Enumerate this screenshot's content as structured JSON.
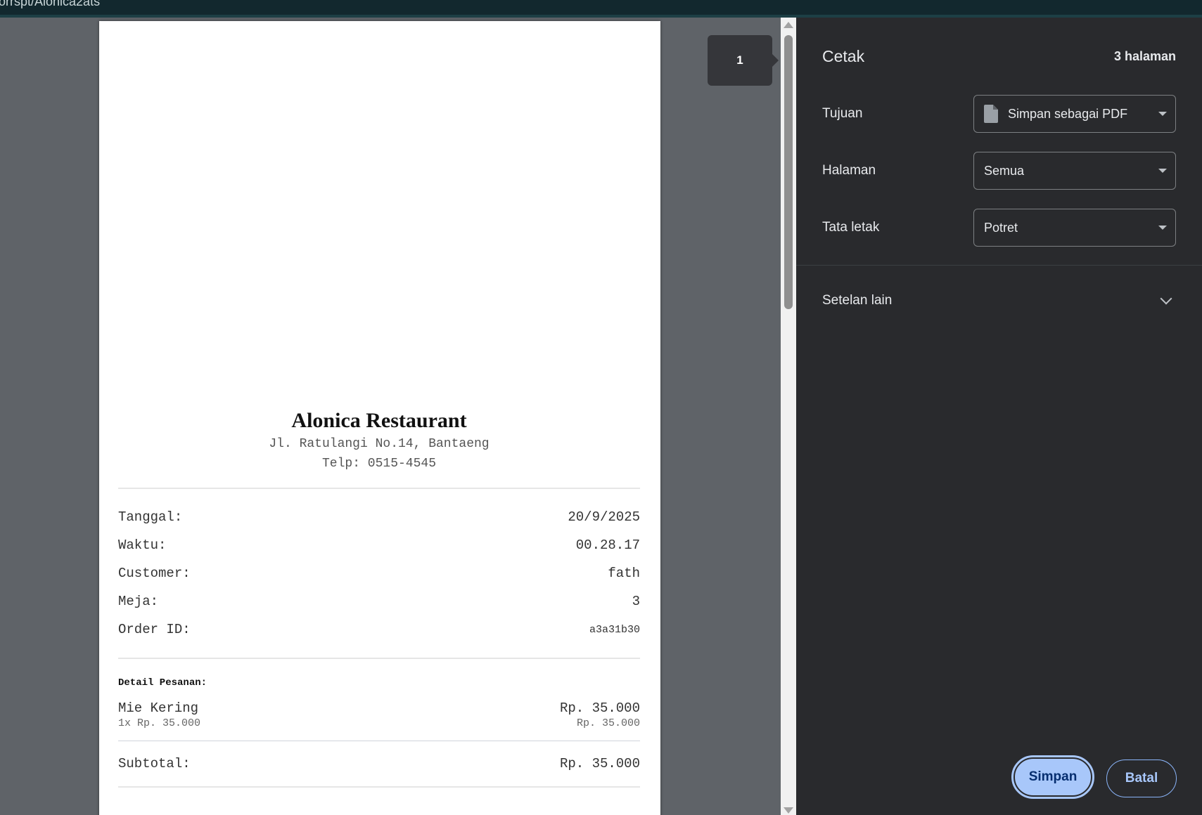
{
  "browser": {
    "url_fragment": "orrspt/Alonica2ats"
  },
  "preview": {
    "page_number": "1",
    "receipt": {
      "restaurant_name": "Alonica Restaurant",
      "address": "Jl. Ratulangi No.14, Bantaeng",
      "phone": "Telp: 0515-4545",
      "info": [
        {
          "label": "Tanggal:",
          "value": "20/9/2025"
        },
        {
          "label": "Waktu:",
          "value": "00.28.17"
        },
        {
          "label": "Customer:",
          "value": "fath"
        },
        {
          "label": "Meja:",
          "value": "3"
        },
        {
          "label": "Order ID:",
          "value": "a3a31b30"
        }
      ],
      "detail_title": "Detail Pesanan:",
      "items": [
        {
          "name": "Mie Kering",
          "total": "Rp. 35.000",
          "qty_price": "1x Rp. 35.000",
          "line_total": "Rp. 35.000"
        }
      ],
      "subtotal_label": "Subtotal:",
      "subtotal_value": "Rp. 35.000"
    }
  },
  "panel": {
    "title": "Cetak",
    "page_count": "3 halaman",
    "destination": {
      "label": "Tujuan",
      "value": "Simpan sebagai PDF",
      "icon": "file-icon"
    },
    "pages": {
      "label": "Halaman",
      "value": "Semua"
    },
    "layout": {
      "label": "Tata letak",
      "value": "Potret"
    },
    "more_settings": "Setelan lain",
    "save_button": "Simpan",
    "cancel_button": "Batal"
  },
  "colors": {
    "panel_bg": "#292a2d",
    "preview_bg": "#5f6368",
    "accent": "#a8c7fa"
  }
}
